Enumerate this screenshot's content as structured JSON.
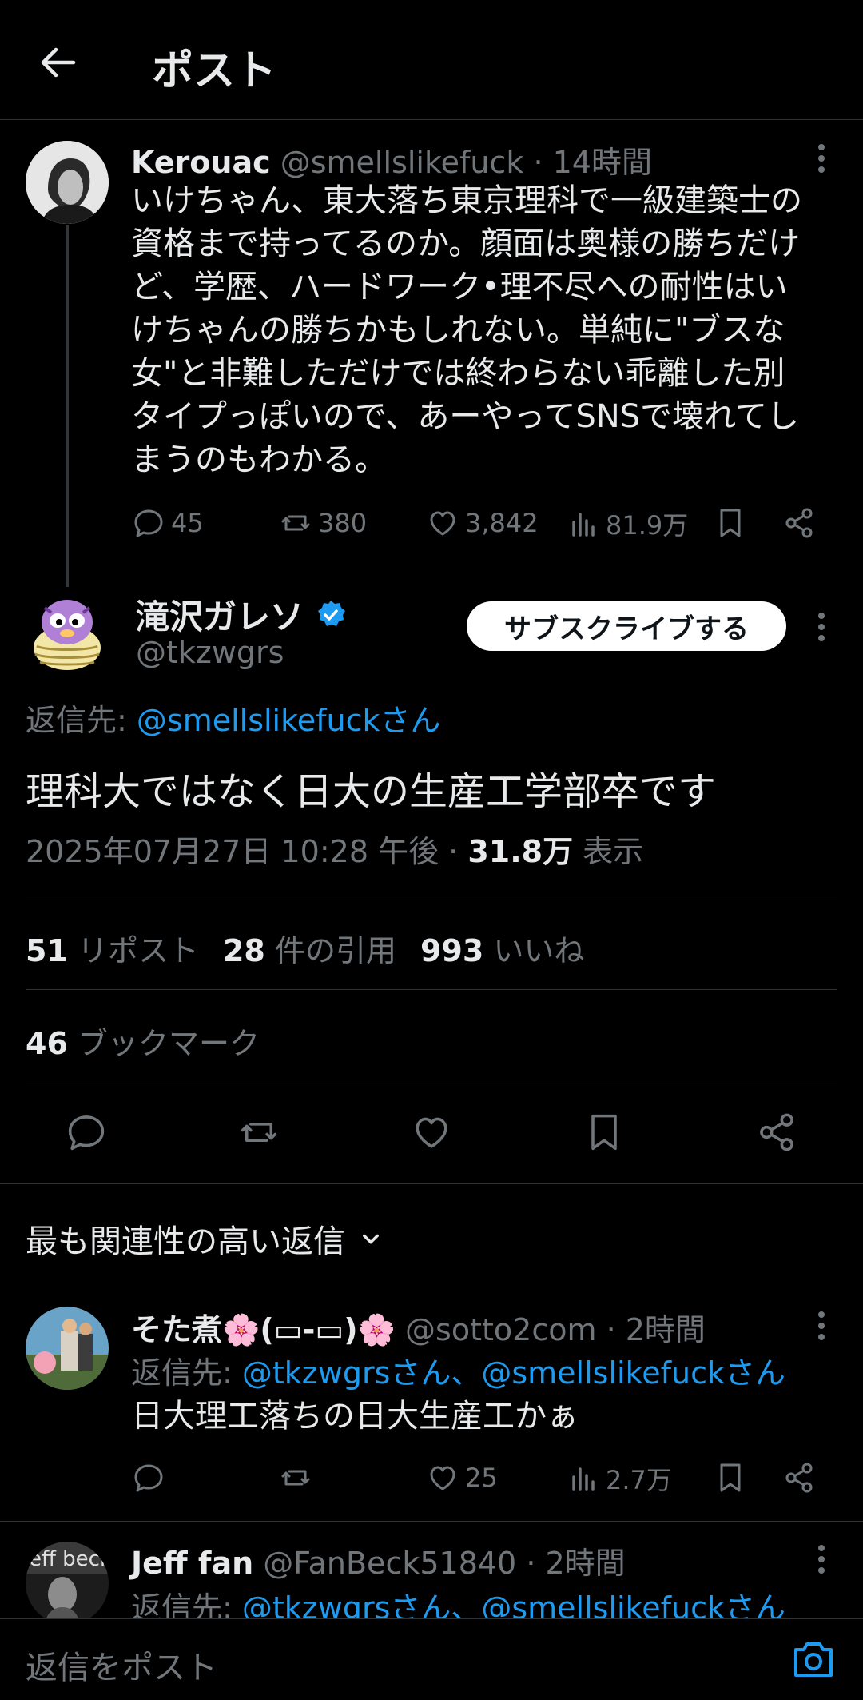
{
  "header": {
    "title": "ポスト"
  },
  "parent_tweet": {
    "name": "Kerouac",
    "handle": "@smellslikefuck",
    "time": "· 14時間",
    "lines": [
      "いけちゃん、東大落ち東京理科で一級建築士の",
      "資格まで持ってるのか。顔面は奥様の勝ちだけ",
      "ど、学歴、ハードワーク•理不尽への耐性はい",
      "けちゃんの勝ちかもしれない。単純に\"ブスな",
      "女\"と非難しただけでは終わらない乖離した別",
      "タイプっぽいので、あーやってSNSで壊れてし",
      "まうのもわかる。"
    ],
    "replies": "45",
    "reposts": "380",
    "likes": "3,842",
    "views": "81.9万"
  },
  "focus_tweet": {
    "name": "滝沢ガレソ",
    "handle": "@tkzwgrs",
    "subscribe_label": "サブスクライブする",
    "reply_to_prefix": "返信先: ",
    "reply_to_user": "@smellslikefuckさん",
    "text": "理科大ではなく日大の生産工学部卒です",
    "datetime": "2025年07月27日 10:28 午後 · ",
    "views_count": "31.8万",
    "views_label": " 表示",
    "reposts_count": "51",
    "reposts_label": " リポスト",
    "quotes_count": "28",
    "quotes_label": " 件の引用",
    "likes_count": "993",
    "likes_label": " いいね",
    "bookmarks_count": "46",
    "bookmarks_label": " ブックマーク"
  },
  "sort": {
    "label": "最も関連性の高い返信"
  },
  "replies": [
    {
      "name": "そた煮🌸(▭-▭)🌸",
      "handle": "@sotto2com",
      "time": "· 2時間",
      "reply_prefix": "返信先: ",
      "reply_users": "@tkzwgrsさん、@smellslikefuckさん",
      "text": "日大理工落ちの日大生産工かぁ",
      "replies": "",
      "reposts": "",
      "likes": "25",
      "views": "2.7万"
    },
    {
      "name": "Jeff fan",
      "handle": "@FanBeck51840",
      "time": "· 2時間",
      "reply_prefix": "返信先: ",
      "reply_users": "@tkzwgrsさん、@smellslikefuckさん"
    }
  ],
  "composer": {
    "placeholder": "返信をポスト"
  },
  "colors": {
    "background": "#000000",
    "accent": "#1d9bf0",
    "muted": "#71767b",
    "text": "#e7e9ea"
  }
}
